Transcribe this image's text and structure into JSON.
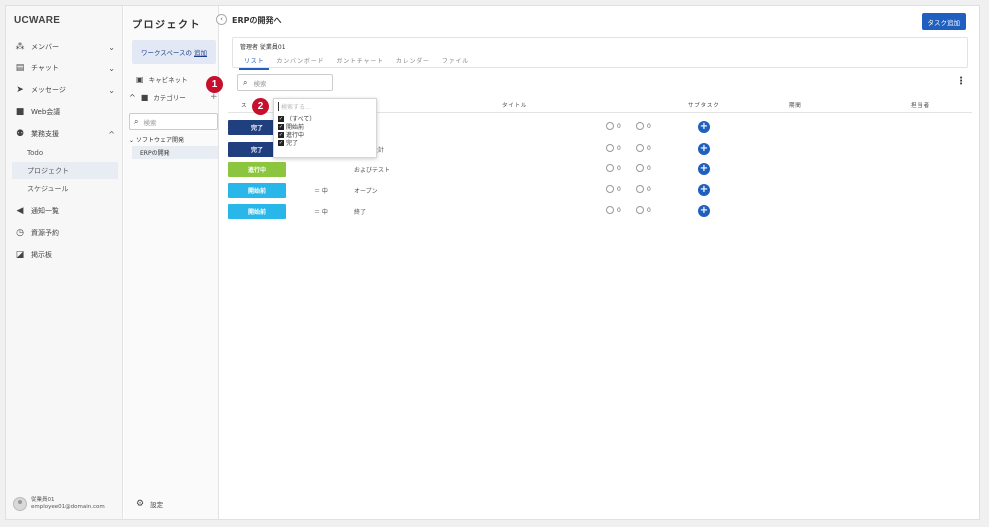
{
  "brand": "UCWARE",
  "nav": {
    "items": [
      {
        "label": "メンバー",
        "icon": "member-icon",
        "chevron": "⌄"
      },
      {
        "label": "チャット",
        "icon": "chat-icon",
        "chevron": "⌄"
      },
      {
        "label": "メッセージ",
        "icon": "message-icon",
        "chevron": "⌄"
      },
      {
        "label": "Web会議",
        "icon": "video-icon"
      },
      {
        "label": "業務支援",
        "icon": "team-icon",
        "chevron": "^"
      },
      {
        "label": "通知一覧",
        "icon": "megaphone-icon"
      },
      {
        "label": "資源予約",
        "icon": "clock-icon"
      },
      {
        "label": "掲示板",
        "icon": "board-icon"
      }
    ],
    "sub": [
      "Todo",
      "プロジェクト",
      "スケジュール"
    ]
  },
  "user": {
    "name": "従業員01",
    "email": "employee01@domain.com"
  },
  "project_col": {
    "title": "プロジェクト",
    "ws_button": "ワークスペースの",
    "ws_button_link": "追加",
    "cabinet": "キャビネット",
    "category": "カテゴリー",
    "search_placeholder": "検索",
    "group": "ソフトウェア開発",
    "leaf": "ERPの開発",
    "settings": "設定"
  },
  "main": {
    "title": "ERPの開発へ",
    "add_task": "タスク追加",
    "manager": "管理者  従業員01",
    "tabs": [
      "リスト",
      "カンバンボード",
      "ガントチャート",
      "カレンダー",
      "ファイル"
    ],
    "search_placeholder": "検索",
    "headers": {
      "status": "ス",
      "title": "タイトル",
      "subtask": "サブタスク",
      "period": "期間",
      "assignee": "担当者"
    },
    "rows": [
      {
        "status": "完了",
        "color": "#1f3f7f",
        "priority": "",
        "title": "",
        "comments": "0",
        "reactions": "0"
      },
      {
        "status": "完了",
        "color": "#1f3f7f",
        "priority": "",
        "title": "および設計",
        "comments": "0",
        "reactions": "0"
      },
      {
        "status": "進行中",
        "color": "#8cc63f",
        "priority": "",
        "title": "およびテスト",
        "comments": "0",
        "reactions": "0"
      },
      {
        "status": "開始前",
        "color": "#29b6e8",
        "priority": "＝ 中",
        "title": "オープン",
        "comments": "0",
        "reactions": "0"
      },
      {
        "status": "開始前",
        "color": "#29b6e8",
        "priority": "＝ 中",
        "title": "終了",
        "comments": "0",
        "reactions": "0"
      }
    ]
  },
  "filter_popup": {
    "search_placeholder": "検索する...",
    "options": [
      "（すべて）",
      "開始前",
      "進行中",
      "完了"
    ]
  },
  "badges": [
    "1",
    "2"
  ]
}
